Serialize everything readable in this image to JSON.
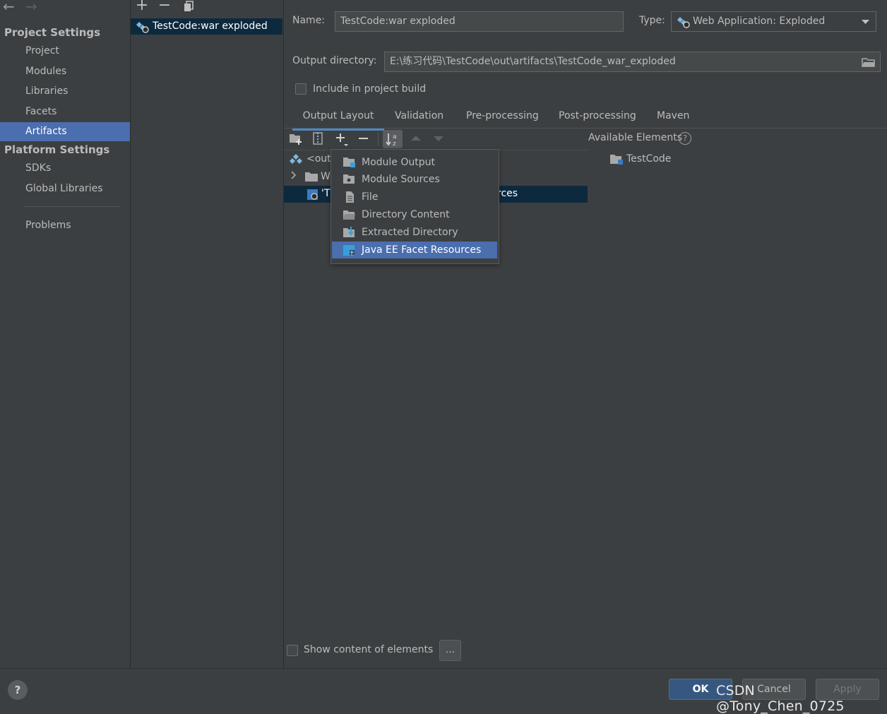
{
  "nav": {
    "back": "←",
    "forward": "→"
  },
  "sidebar": {
    "project_settings_title": "Project Settings",
    "project_items": [
      "Project",
      "Modules",
      "Libraries",
      "Facets",
      "Artifacts"
    ],
    "platform_settings_title": "Platform Settings",
    "platform_items": [
      "SDKs",
      "Global Libraries"
    ],
    "problems": "Problems",
    "selected": "Artifacts"
  },
  "artifacts": {
    "toolbar": {
      "add": "+",
      "remove": "−"
    },
    "items": [
      "TestCode:war exploded"
    ]
  },
  "form": {
    "name_label": "Name:",
    "name_value": "TestCode:war exploded",
    "type_label": "Type:",
    "type_value": "Web Application: Exploded",
    "output_dir_label": "Output directory:",
    "output_dir_value": "E:\\练习代码\\TestCode\\out\\artifacts\\TestCode_war_exploded",
    "include_in_build": "Include in project build",
    "include_checked": false
  },
  "tabs": [
    "Output Layout",
    "Validation",
    "Pre-processing",
    "Post-processing",
    "Maven"
  ],
  "active_tab": "Output Layout",
  "tree": {
    "root": "<outp",
    "child1": "W",
    "child2_prefix": "'T",
    "child2_suffix": "rces"
  },
  "available": {
    "title": "Available Elements",
    "help": "?",
    "items": [
      "TestCode"
    ]
  },
  "popup_menu": {
    "items": [
      "Module Output",
      "Module Sources",
      "File",
      "Directory Content",
      "Extracted Directory",
      "Java EE Facet Resources"
    ],
    "highlighted": "Java EE Facet Resources"
  },
  "show_content": {
    "label": "Show content of elements",
    "checked": false,
    "more_button": "..."
  },
  "footer": {
    "help": "?",
    "ok": "OK",
    "cancel": "Cancel",
    "apply": "Apply",
    "watermark": "CSDN @Tony_Chen_0725"
  },
  "colors": {
    "background": "#3c3f41",
    "selection": "#4b6eaf",
    "tree_selection": "#0d293e",
    "accent": "#4a88c7"
  }
}
